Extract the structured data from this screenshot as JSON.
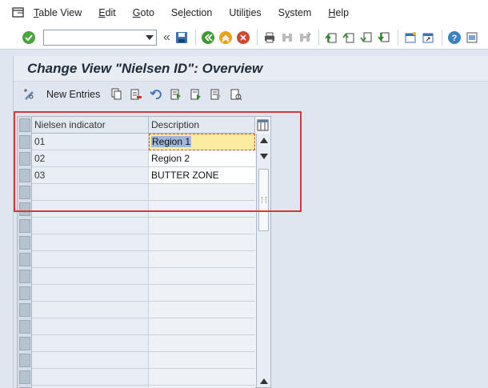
{
  "menu": {
    "items": [
      {
        "label": "Table View",
        "underline": "T"
      },
      {
        "label": "Edit",
        "underline": "E"
      },
      {
        "label": "Goto",
        "underline": "G"
      },
      {
        "label": "Selection",
        "underline": "l"
      },
      {
        "label": "Utilities",
        "underline": "t"
      },
      {
        "label": "System",
        "underline": "y"
      },
      {
        "label": "Help",
        "underline": "H"
      }
    ]
  },
  "toolbar": {
    "command_value": "",
    "icons": [
      "enter-icon",
      "back-double-arrow-icon",
      "save-icon",
      "back-icon",
      "exit-icon",
      "cancel-icon",
      "print-icon",
      "find-icon",
      "find-next-icon",
      "first-page-icon",
      "previous-page-icon",
      "next-page-icon",
      "last-page-icon",
      "create-session-icon",
      "shortcut-icon",
      "help-icon",
      "layout-icon"
    ]
  },
  "page": {
    "title": "Change View \"Nielsen ID\": Overview"
  },
  "app_toolbar": {
    "new_entries_label": "New Entries"
  },
  "table": {
    "columns": [
      "Nielsen indicator",
      "Description"
    ],
    "rows": [
      {
        "key": "01",
        "desc": "Region 1"
      },
      {
        "key": "02",
        "desc": "Region 2"
      },
      {
        "key": "03",
        "desc": "BUTTER ZONE"
      }
    ],
    "empty_row_count": 13
  },
  "colors": {
    "highlight_border": "#d03a3a",
    "focus_cell": "#fdec9f",
    "selection": "#9fb8d9",
    "background": "#dfe6ef"
  }
}
